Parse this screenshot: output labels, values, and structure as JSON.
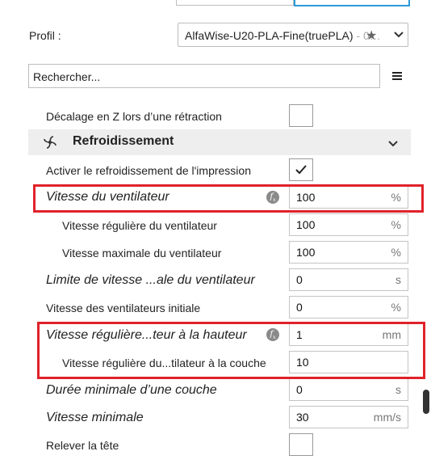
{
  "profile": {
    "label": "Profil :",
    "value": "AlfaWise-U20-PLA-Fine(truePLA)",
    "value_suffix": " - 0…"
  },
  "search": {
    "value": "Rechercher..."
  },
  "rows": {
    "retraction_z": "Décalage en Z lors d’une rétraction",
    "section_title": "Refroidissement",
    "enable_cooling": "Activer le refroidissement de l'impression",
    "fan_speed": "Vitesse du ventilateur",
    "fan_speed_min": "Vitesse régulière du ventilateur",
    "fan_speed_max": "Vitesse maximale du ventilateur",
    "fan_threshold": "Limite de vitesse ...ale du ventilateur",
    "initial_fan": "Vitesse des ventilateurs initiale",
    "regular_height": "Vitesse régulière...teur à la hauteur",
    "regular_layer": "Vitesse régulière du...tilateur à la couche",
    "min_layer_time": "Durée minimale d’une couche",
    "min_speed": "Vitesse minimale",
    "lift_head": "Relever la tête"
  },
  "values": {
    "fan_speed": "100",
    "fan_speed_min": "100",
    "fan_speed_max": "100",
    "fan_threshold": "0",
    "initial_fan": "0",
    "regular_height": "1",
    "regular_layer": "10",
    "min_layer_time": "0",
    "min_speed": "30"
  },
  "units": {
    "percent": "%",
    "seconds": "s",
    "mm": "mm",
    "mms": "mm/s"
  },
  "checks": {
    "retraction_z": false,
    "enable_cooling": true,
    "lift_head": false
  },
  "icons": {
    "fx": "fx-icon",
    "fan": "fan-icon",
    "star": "star-icon",
    "menu": "menu-icon"
  },
  "colors": {
    "highlight_red": "#e0222a",
    "tab_blue": "#2b9bd8"
  }
}
